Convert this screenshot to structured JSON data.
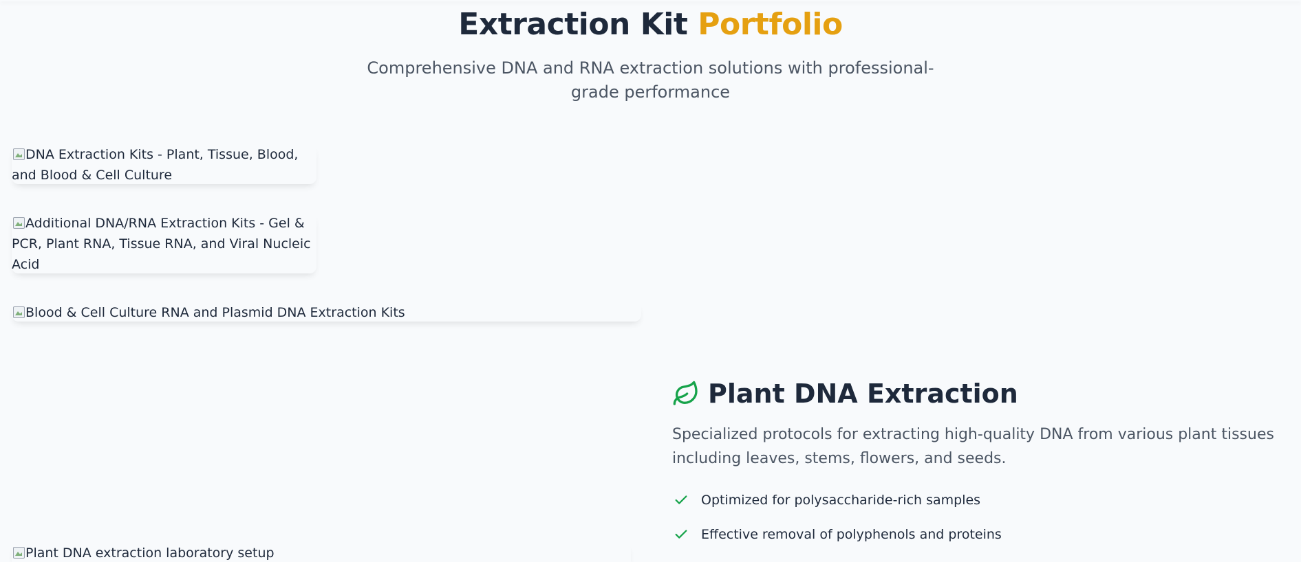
{
  "header": {
    "title_main": "Extraction Kit",
    "title_accent": "Portfolio",
    "subtitle": "Comprehensive DNA and RNA extraction solutions with professional-grade performance"
  },
  "images": {
    "dna_kits_alt": "DNA Extraction Kits - Plant, Tissue, Blood, and Blood & Cell Culture",
    "additional_kits_alt": "Additional DNA/RNA Extraction Kits - Gel & PCR, Plant RNA, Tissue RNA, and Viral Nucleic Acid",
    "rna_plasmid_alt": "Blood & Cell Culture RNA and Plasmid DNA Extraction Kits",
    "plant_lab_alt": "Plant DNA extraction laboratory setup"
  },
  "feature": {
    "icon": "leaf-icon",
    "title": "Plant DNA Extraction",
    "description": "Specialized protocols for extracting high-quality DNA from various plant tissues including leaves, stems, flowers, and seeds.",
    "points": [
      "Optimized for polysaccharide-rich samples",
      "Effective removal of polyphenols and proteins"
    ]
  },
  "colors": {
    "accent": "#e5a011",
    "heading": "#1e293b",
    "muted": "#4b5563",
    "green": "#16a34a",
    "background": "#f8fafc"
  }
}
